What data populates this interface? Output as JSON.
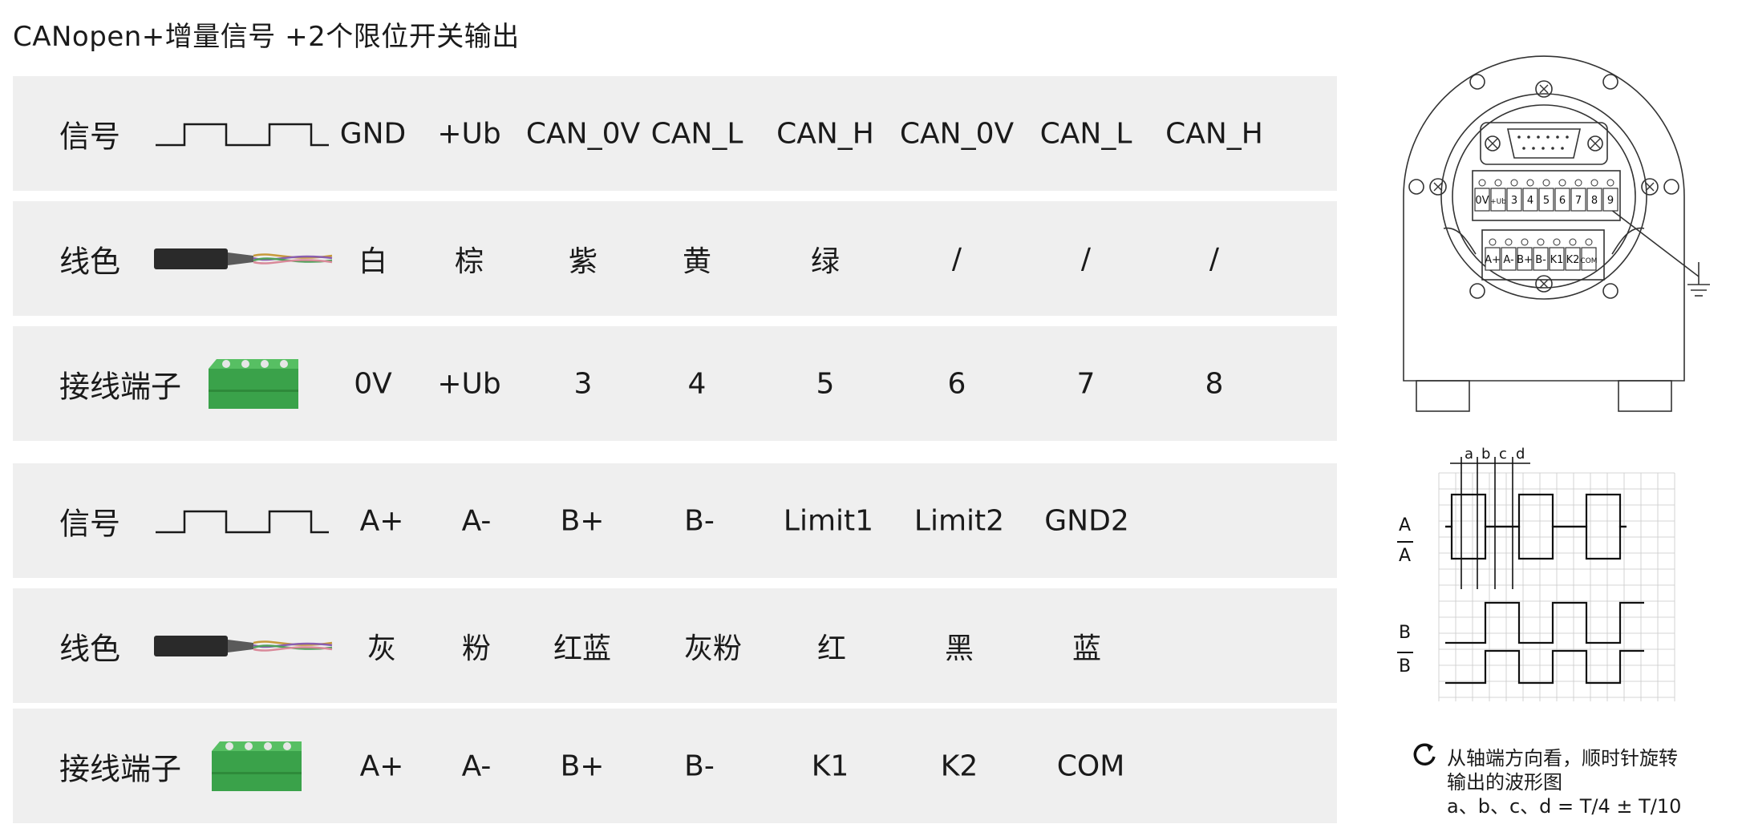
{
  "title": "CANopen+增量信号 +2个限位开关输出",
  "table1": {
    "rows": [
      {
        "label": "信号",
        "icon": "square-wave-icon",
        "cells": [
          "GND",
          "+Ub",
          "CAN_0V",
          "CAN_L",
          "CAN_H",
          "CAN_0V",
          "CAN_L",
          "CAN_H"
        ]
      },
      {
        "label": "线色",
        "icon": "cable-icon",
        "cells": [
          "白",
          "棕",
          "紫",
          "黄",
          "绿",
          "/",
          "/",
          "/"
        ]
      },
      {
        "label": "接线端子",
        "icon": "terminal-block-icon",
        "cells": [
          "0V",
          "+Ub",
          "3",
          "4",
          "5",
          "6",
          "7",
          "8"
        ]
      }
    ]
  },
  "table2": {
    "rows": [
      {
        "label": "信号",
        "icon": "square-wave-icon",
        "cells": [
          "A+",
          "A-",
          "B+",
          "B-",
          "Limit1",
          "Limit2",
          "GND2"
        ]
      },
      {
        "label": "线色",
        "icon": "cable-icon",
        "cells": [
          "灰",
          "粉",
          "红蓝",
          "灰粉",
          "红",
          "黑",
          "蓝"
        ]
      },
      {
        "label": "接线端子",
        "icon": "terminal-block-icon",
        "cells": [
          "A+",
          "A-",
          "B+",
          "B-",
          "K1",
          "K2",
          "COM"
        ]
      }
    ]
  },
  "encoder_drawing": {
    "terminals_top": [
      "0V",
      "+Ub",
      "3",
      "4",
      "5",
      "6",
      "7",
      "8",
      "9"
    ],
    "terminals_bottom": [
      "A+",
      "A-",
      "B+",
      "B-",
      "K1",
      "K2",
      "COM"
    ]
  },
  "waveform": {
    "phase_labels": [
      "a",
      "b",
      "c",
      "d"
    ],
    "channels": [
      "A",
      "A",
      "B",
      "B"
    ]
  },
  "notes": {
    "line1": "从轴端方向看，顺时针旋转",
    "line2": "输出的波形图",
    "line3": "a、b、c、d = T/4 ± T/10"
  },
  "colors": {
    "row_bg": "#efefef",
    "terminal_green": "#3aa24a",
    "cable_black": "#2a2a2a"
  }
}
